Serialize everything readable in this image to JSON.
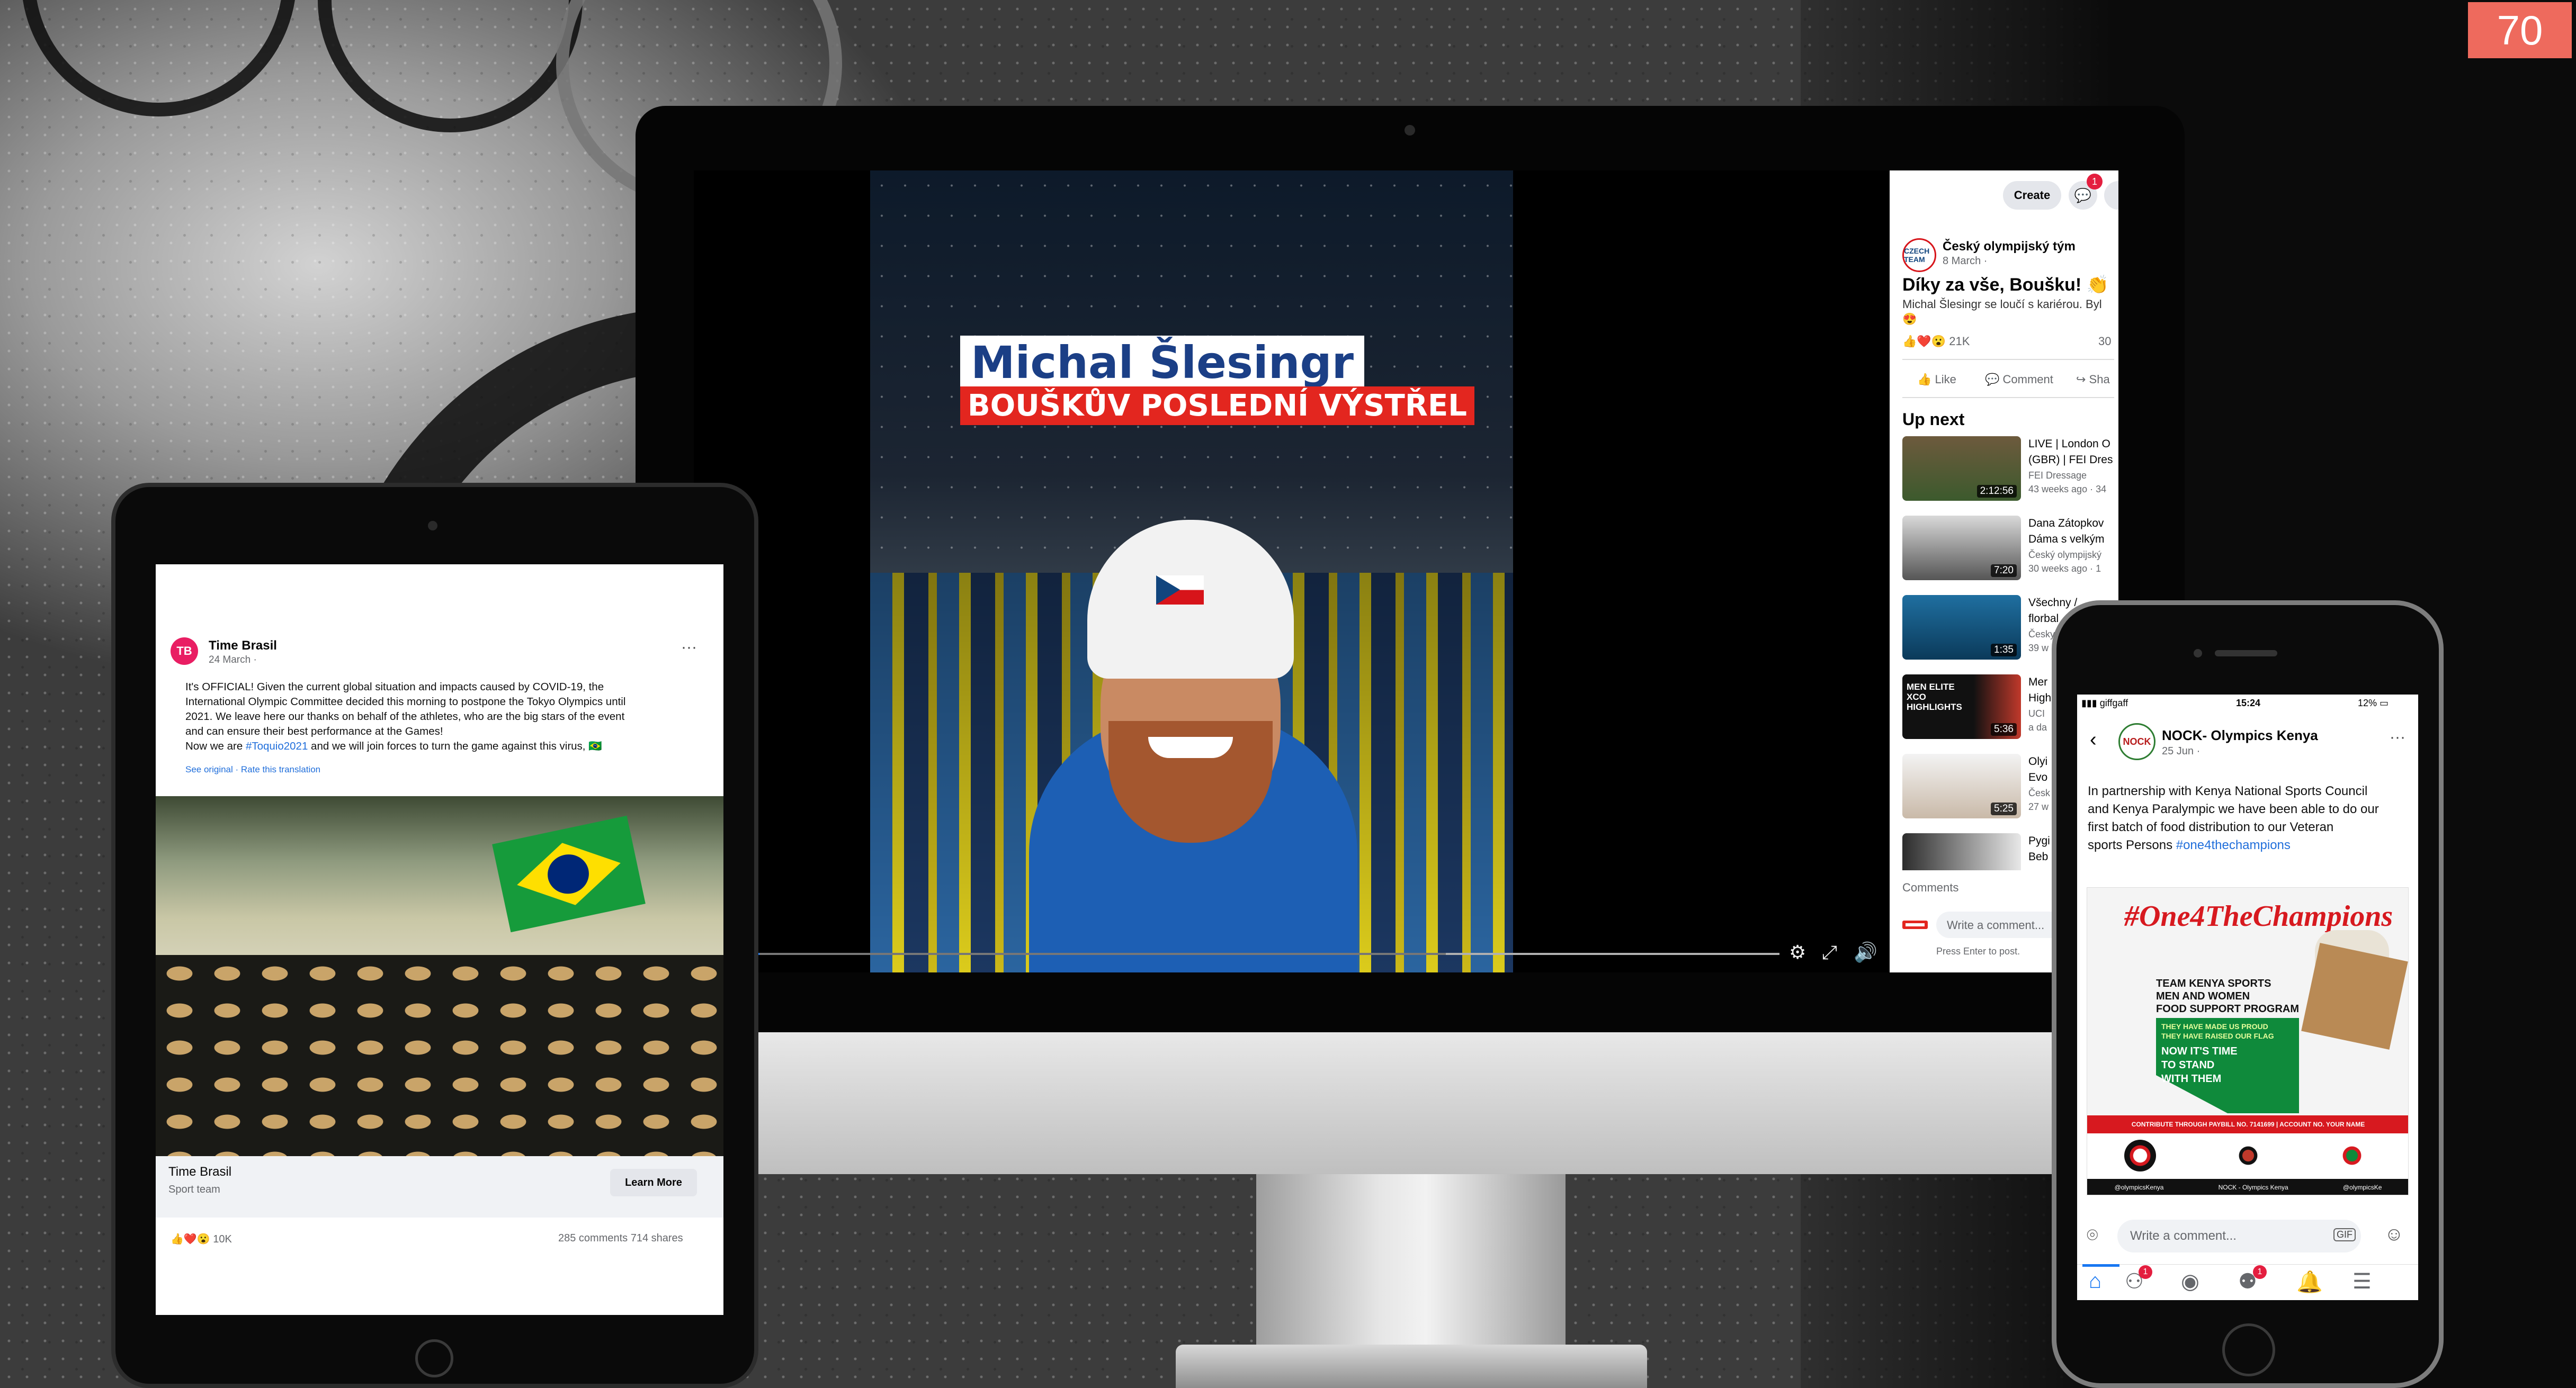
{
  "badge": "70",
  "colors": {
    "fb_blue": "#1877f2",
    "czech_red": "#e3261f",
    "kenya_red": "#d7191f",
    "badge": "#ee6a5d"
  },
  "imac": {
    "video": {
      "title_name": "Michal Šlesingr",
      "title_sub": "BOUŠKŮV POSLEDNÍ VÝSTŘEL",
      "progress_fraction": 0.0,
      "controls": [
        "settings-icon",
        "fullscreen-icon",
        "volume-icon"
      ]
    },
    "topbar": {
      "create_label": "Create",
      "messenger_badge": "1"
    },
    "post": {
      "avatar_text": "CZECH TEAM",
      "page_name": "Český olympijský tým",
      "date": "8 March ·",
      "title": "Díky za vše, Boušku! 👏",
      "description": "Michal Šlesingr se loučí s kariérou. Byl",
      "emoji": "😍",
      "reactions": "21K",
      "comments_count": "30",
      "like_label": "Like",
      "comment_label": "Comment",
      "share_label": "Sha"
    },
    "up_next_title": "Up next",
    "up_next": [
      {
        "title1": "LIVE | London O",
        "title2": "(GBR) | FEI Dres",
        "channel": "FEI Dressage",
        "meta": "43 weeks ago · 34",
        "duration": "2:12:56"
      },
      {
        "title1": "Dana Zátopkov",
        "title2": "Dáma s velkým",
        "channel": "Český olympijský",
        "meta": "30 weeks ago · 1",
        "duration": "7:20"
      },
      {
        "title1": "Všechny /",
        "title2": "florbal",
        "channel": "Česky",
        "meta": "39 w",
        "duration": "1:35"
      },
      {
        "title1": "Mer",
        "title2": "High",
        "channel": "UCI",
        "meta": "a da",
        "duration": "5:36"
      },
      {
        "title1": "Olyi",
        "title2": "Evo",
        "channel": "Česk",
        "meta": "27 w",
        "duration": "5:25"
      },
      {
        "title1": "Pygi",
        "title2": "Beb",
        "channel": "",
        "meta": "",
        "duration": ""
      }
    ],
    "thumb4_text": "MEN ELITE XCO HIGHLIGHTS",
    "comments_label": "Comments",
    "write_placeholder": "Write a comment...",
    "enter_hint": "Press Enter to post."
  },
  "ipad": {
    "page_name": "Time Brasil",
    "date": "24 March ·",
    "avatar_text": "TB",
    "text_lines": [
      "It's OFFICIAL! Given the current global situation and impacts caused by COVID-19, the",
      "International Olympic Committee decided this morning to postpone the Tokyo Olympics until",
      "2021. We leave here our thanks on behalf of the athletes, who are the big stars of the event",
      "and can ensure their best performance at the Games!"
    ],
    "line5_pre": "Now we are ",
    "hashtag": "#Toquio2021",
    "line5_post": " and we will join forces to turn the game against this virus, 🇧🇷",
    "translate": "See original · Rate this translation",
    "link_name": "Time Brasil",
    "link_sub": "Sport team",
    "learn_more": "Learn More",
    "reactions": "10K",
    "stats": "285 comments  714 shares"
  },
  "iphone": {
    "status_left": "giffgaff",
    "status_time": "15:24",
    "status_right": "12%",
    "page_name": "NOCK- Olympics Kenya",
    "date": "25 Jun ·",
    "avatar_text": "NOCK",
    "text_lines": [
      "In partnership with Kenya National Sports Council",
      "and Kenya Paralympic we have been able to do our",
      "first batch of food distribution to our Veteran"
    ],
    "line4_pre": "sports Persons ",
    "hashtag": "#one4thechampions",
    "poster": {
      "hashtag": "#One4TheChampions",
      "program1": "TEAM KENYA SPORTS",
      "program2": "MEN AND WOMEN",
      "program3": "FOOD SUPPORT PROGRAM",
      "small1": "THEY HAVE MADE US PROUD",
      "small2": "THEY HAVE RAISED OUR FLAG",
      "big1": "NOW IT'S TIME",
      "big2": "TO STAND",
      "big3": "WITH THEM",
      "band": "CONTRIBUTE THROUGH PAYBILL NO. 7141699 | ACCOUNT NO. YOUR NAME",
      "footer1": "@olympicsKenya",
      "footer2": "NOCK - Olympics Kenya",
      "footer3": "@olympicsKe"
    },
    "write_placeholder": "Write a comment...",
    "gif_label": "GIF",
    "tab_badges": [
      "1",
      "1"
    ]
  }
}
